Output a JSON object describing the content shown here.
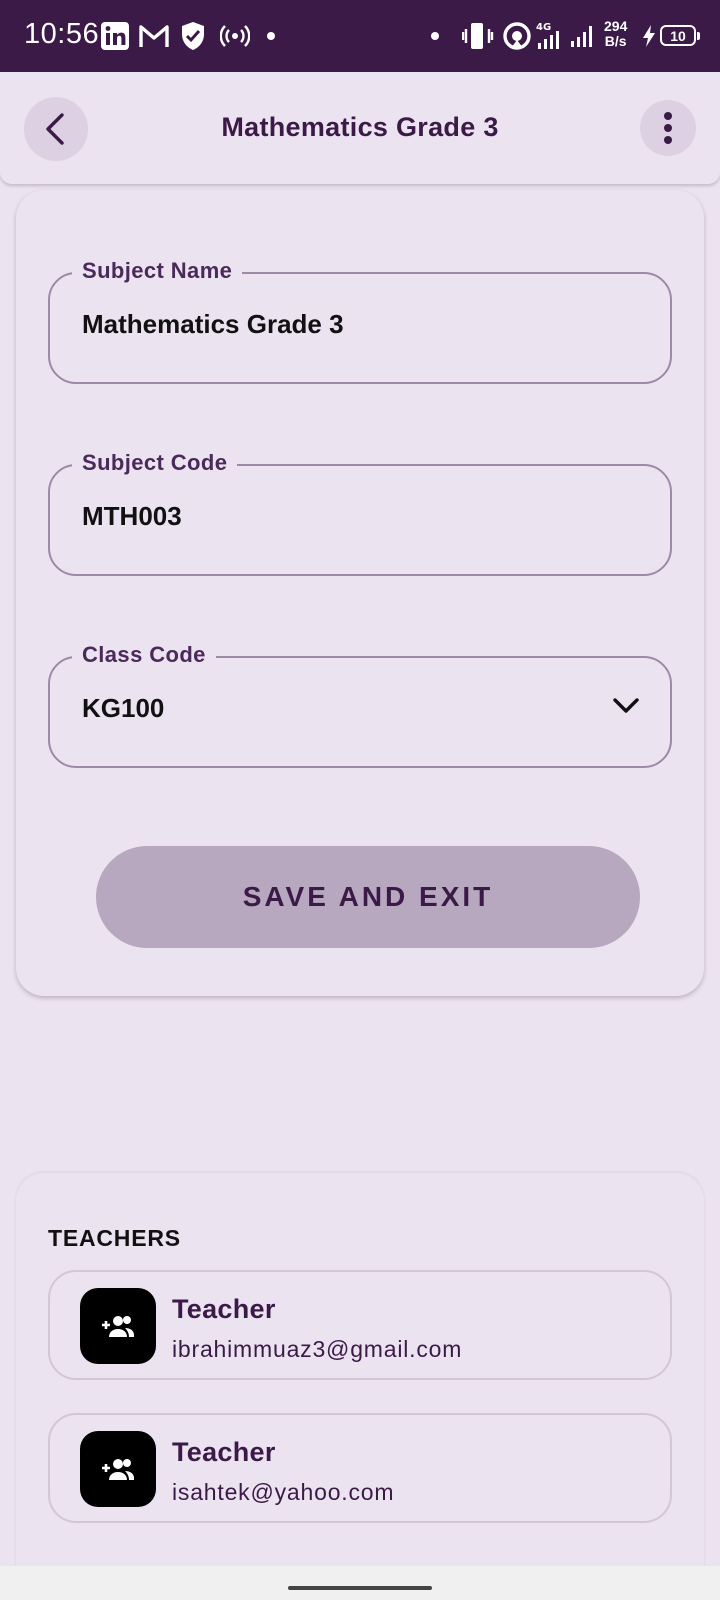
{
  "status_bar": {
    "time": "10:56",
    "net_speed_value": "294",
    "net_speed_unit": "B/s",
    "network_type": "4G",
    "battery": "10",
    "icons": [
      "linkedin-icon",
      "gmail-icon",
      "shield-icon",
      "hotspot-icon",
      "dot-icon",
      "vibrate-icon",
      "wifi-icon",
      "signal-icon",
      "charging-icon"
    ]
  },
  "app_bar": {
    "title": "Mathematics Grade 3",
    "back_icon": "chevron-left-icon",
    "menu_icon": "more-vert-icon"
  },
  "form": {
    "subject_name": {
      "label": "Subject Name",
      "value": "Mathematics Grade 3"
    },
    "subject_code": {
      "label": "Subject Code",
      "value": "MTH003"
    },
    "class_code": {
      "label": "Class Code",
      "value": "KG100"
    },
    "save_label": "SAVE AND EXIT"
  },
  "teachers": {
    "title": "TEACHERS",
    "items": [
      {
        "role": "Teacher",
        "email": "ibrahimmuaz3@gmail.com"
      },
      {
        "role": "Teacher",
        "email": "isahtek@yahoo.com"
      }
    ]
  },
  "colors": {
    "status_bar_bg": "#3b1a47",
    "page_bg": "#ece3f1",
    "accent_text": "#3b1a47",
    "button_bg": "#b8a8bf",
    "avatar_bg": "#000000"
  }
}
